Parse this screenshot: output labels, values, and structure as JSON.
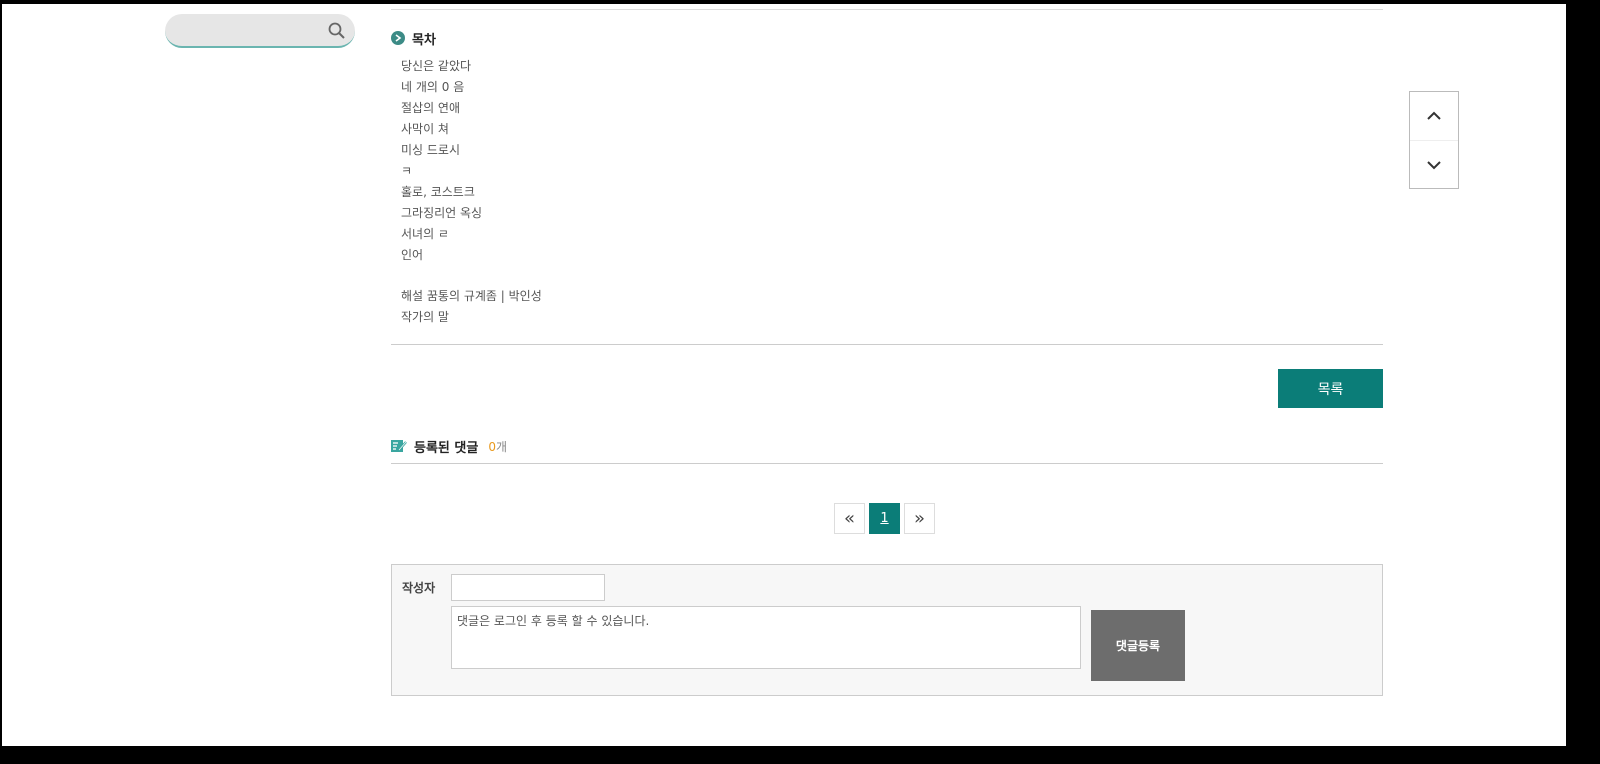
{
  "search": {
    "placeholder": ""
  },
  "toc": {
    "title": "목차",
    "items": [
      "당신은 같았다",
      "네 개의 0 음",
      "절삽의 연애",
      "사막이 쳐",
      "미싱 드로시",
      "ㅋ",
      "홀로, 코스트크",
      "그라징리언 옥싱",
      "서녀의 ㄹ",
      "인어"
    ],
    "extras": [
      "해설 꿈통의 규계좀 | 박인성",
      "작가의 말"
    ]
  },
  "list_button": {
    "label": "목록"
  },
  "comments": {
    "title": "등록된 댓글",
    "count": "0",
    "count_unit": "개"
  },
  "pagination": {
    "first": "«",
    "current": "1",
    "last": "»"
  },
  "comment_form": {
    "author_label": "작성자",
    "author_value": "",
    "textarea_text": "댓글은 로그인 후 등록 할 수 있습니다.",
    "submit_label": "댓글등록"
  },
  "colors": {
    "accent": "#0b7d78",
    "count_highlight": "#e99a1f",
    "submit_bg": "#6d6d6d"
  }
}
